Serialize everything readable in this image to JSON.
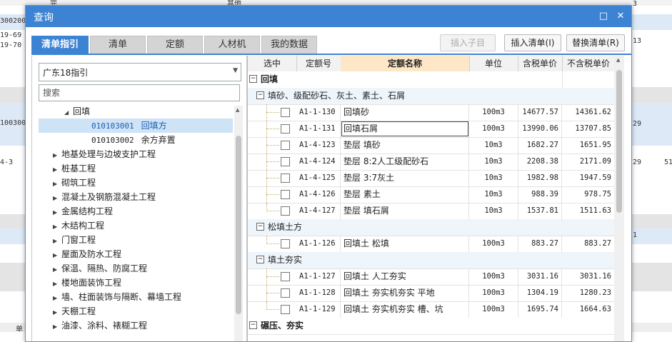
{
  "dialog": {
    "title": "查询",
    "minimize_glyph": "□",
    "close_glyph": "✕"
  },
  "tabs": [
    {
      "label": "清单指引",
      "active": true
    },
    {
      "label": "清单"
    },
    {
      "label": "定额"
    },
    {
      "label": "人材机"
    },
    {
      "label": "我的数据"
    }
  ],
  "toolbar": {
    "insert_child": "插入子目",
    "insert_list": "插入清单(I)",
    "replace_list": "替换清单(R)"
  },
  "left": {
    "guide_select": "广东18指引",
    "search_placeholder": "搜索",
    "tree": [
      {
        "label": "回填",
        "arrow": "◢"
      },
      {
        "code": "010103001",
        "label": "回填方"
      },
      {
        "code": "010103002",
        "label": "余方弃置"
      },
      {
        "label": "地基处理与边坡支护工程",
        "arrow": "▶"
      },
      {
        "label": "桩基工程",
        "arrow": "▶"
      },
      {
        "label": "砌筑工程",
        "arrow": "▶"
      },
      {
        "label": "混凝土及钢筋混凝土工程",
        "arrow": "▶"
      },
      {
        "label": "金属结构工程",
        "arrow": "▶"
      },
      {
        "label": "木结构工程",
        "arrow": "▶"
      },
      {
        "label": "门窗工程",
        "arrow": "▶"
      },
      {
        "label": "屋面及防水工程",
        "arrow": "▶"
      },
      {
        "label": "保温、隔热、防腐工程",
        "arrow": "▶"
      },
      {
        "label": "楼地面装饰工程",
        "arrow": "▶"
      },
      {
        "label": "墙、柱面装饰与隔断、幕墙工程",
        "arrow": "▶"
      },
      {
        "label": "天棚工程",
        "arrow": "▶"
      },
      {
        "label": "油漆、涂料、裱糊工程",
        "arrow": "▶"
      }
    ]
  },
  "grid": {
    "headers": [
      "选中",
      "定额号",
      "定额名称",
      "单位",
      "含税单价",
      "不含税单价"
    ],
    "group1": "回填",
    "sub1": "填砂、级配砂石、灰土、素土、石屑",
    "rows1": [
      {
        "code": "A1-1-130",
        "name": "回填砂",
        "unit": "100m3",
        "tax": "14677.57",
        "notax": "14361.62"
      },
      {
        "code": "A1-1-131",
        "name": "回填石屑",
        "unit": "100m3",
        "tax": "13990.06",
        "notax": "13707.85"
      },
      {
        "code": "A1-4-123",
        "name": "垫层 填砂",
        "unit": "10m3",
        "tax": "1682.27",
        "notax": "1651.95"
      },
      {
        "code": "A1-4-124",
        "name": "垫层 8:2人工级配砂石",
        "unit": "10m3",
        "tax": "2208.38",
        "notax": "2171.09"
      },
      {
        "code": "A1-4-125",
        "name": "垫层 3:7灰土",
        "unit": "10m3",
        "tax": "1982.98",
        "notax": "1947.59"
      },
      {
        "code": "A1-4-126",
        "name": "垫层 素土",
        "unit": "10m3",
        "tax": "988.39",
        "notax": "978.75"
      },
      {
        "code": "A1-4-127",
        "name": "垫层 填石屑",
        "unit": "10m3",
        "tax": "1537.81",
        "notax": "1511.63"
      }
    ],
    "sub2": "松填土方",
    "rows2": [
      {
        "code": "A1-1-126",
        "name": "回填土 松填",
        "unit": "100m3",
        "tax": "883.27",
        "notax": "883.27"
      }
    ],
    "sub3": "填土夯实",
    "rows3": [
      {
        "code": "A1-1-127",
        "name": "回填土 人工夯实",
        "unit": "100m3",
        "tax": "3031.16",
        "notax": "3031.16"
      },
      {
        "code": "A1-1-128",
        "name": "回填土 夯实机夯实 平地",
        "unit": "100m3",
        "tax": "1304.19",
        "notax": "1280.23"
      },
      {
        "code": "A1-1-129",
        "name": "回填土 夯实机夯实 槽、坑",
        "unit": "100m3",
        "tax": "1695.74",
        "notax": "1664.63"
      }
    ],
    "group2": "碾压、夯实"
  },
  "background": {
    "t1": "完",
    "t2": "其他",
    "t3": "300200",
    "t4": "19-69",
    "t5": "19-70",
    "t6": "100300",
    "t7": "4-3",
    "t8": "3",
    "t9": "13",
    "t10": "29",
    "t11": "29",
    "t12": "51",
    "t13": "1",
    "t14": "单"
  }
}
